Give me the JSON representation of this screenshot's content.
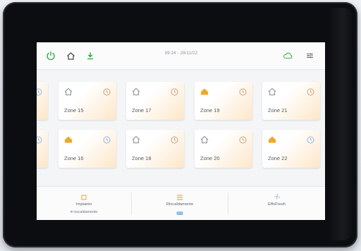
{
  "header": {
    "datetime": "09:24 - 29/11/22"
  },
  "icons": {
    "power": "power-icon",
    "home": "home-icon",
    "download": "download-icon",
    "cloud": "cloud-icon",
    "settings": "sliders-icon"
  },
  "colors": {
    "accent_green": "#3cb54a",
    "accent_orange": "#f5a623",
    "home_grey": "#a5a8ad",
    "clock_blue": "#8fb7e0"
  },
  "zones": {
    "row1": [
      {
        "name": "Zone 15",
        "active": false
      },
      {
        "name": "Zone 17",
        "active": false
      },
      {
        "name": "Zone 19",
        "active": true
      },
      {
        "name": "Zone 21",
        "active": false
      }
    ],
    "row2": [
      {
        "name": "Zone 16",
        "active": true
      },
      {
        "name": "Zone 18",
        "active": false
      },
      {
        "name": "Zone 20",
        "active": false
      },
      {
        "name": "Zone 22",
        "active": true
      }
    ]
  },
  "bottom": {
    "impianto": {
      "label": "Impianto",
      "sub": "in riscaldamento"
    },
    "riscaldamento": {
      "label": "Riscaldamento"
    },
    "effofresh": {
      "label": "EffoFresh"
    }
  }
}
